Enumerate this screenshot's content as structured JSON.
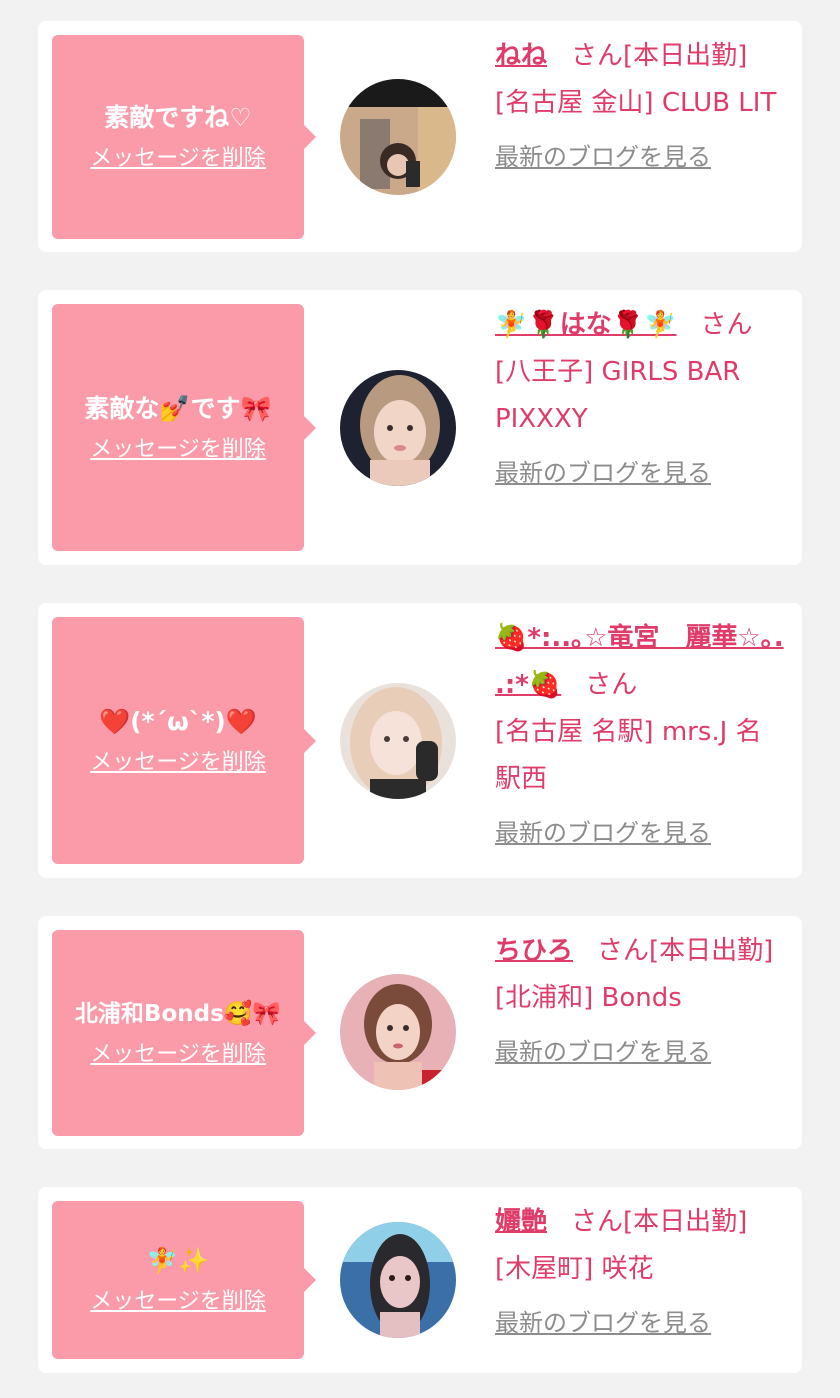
{
  "cards": [
    {
      "message": "素敵ですね♡",
      "delete_label": "メッセージを削除",
      "name": "ねね",
      "honorific": "さん",
      "status": "[本日出勤]",
      "shop": "[名古屋 金山] CLUB LIT",
      "blog_label": "最新のブログを見る"
    },
    {
      "message": "素敵な💅です🎀",
      "delete_label": "メッセージを削除",
      "name": "🧚🌹はな🌹🧚",
      "honorific": "さん",
      "status": "",
      "shop": "[八王子] GIRLS BAR PIXXXY",
      "blog_label": "最新のブログを見る"
    },
    {
      "message": "❤️(*´ω`*)❤️",
      "delete_label": "メッセージを削除",
      "name": "🍓*:..｡☆竜宮　麗華☆｡. .:*🍓",
      "honorific": "さん",
      "status": "",
      "shop": "[名古屋 名駅] mrs.J 名駅西",
      "blog_label": "最新のブログを見る"
    },
    {
      "message": "北浦和Bonds🥰🎀",
      "delete_label": "メッセージを削除",
      "name": "ちひろ",
      "honorific": "さん",
      "status": "[本日出勤]",
      "shop": "[北浦和] Bonds",
      "blog_label": "最新のブログを見る"
    },
    {
      "message": "🧚✨",
      "delete_label": "メッセージを削除",
      "name": "孋艶",
      "honorific": "さん",
      "status": "[本日出勤]",
      "shop": "[木屋町] 咲花",
      "blog_label": "最新のブログを見る"
    }
  ],
  "colors": {
    "page_background": "#f2f2f2",
    "card_background": "#ffffff",
    "bubble": "#fb9aa9",
    "accent_text": "#e03c6a",
    "link_gray": "#8c8c8c"
  }
}
